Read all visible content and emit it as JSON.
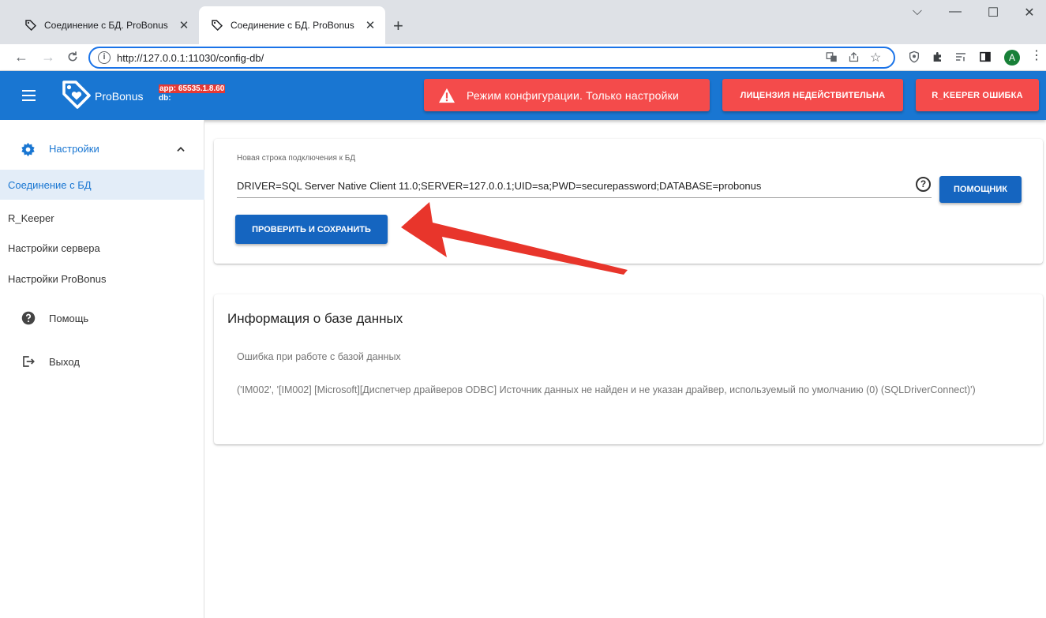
{
  "browser": {
    "tabs": [
      {
        "title": "Соединение с БД. ProBonus",
        "close": "✕"
      },
      {
        "title": "Соединение с БД. ProBonus",
        "close": "✕"
      }
    ],
    "new_tab": "+",
    "window_controls": [
      "⌵",
      "—",
      "☐",
      "✕"
    ],
    "url": "http://127.0.0.1:11030/config-db/",
    "profile_initial": "A"
  },
  "header": {
    "brand": "ProBonus",
    "app_version": "app: 65535.1.8.60",
    "db_label": "db:",
    "mode_banner": "Режим конфигурации. Только настройки",
    "license_button": "ЛИЦЕНЗИЯ НЕДЕЙСТВИТЕЛЬНА",
    "keeper_button": "R_KEEPER ОШИБКА",
    "colors": {
      "appbar": "#1976d2",
      "alert": "#f44b4b"
    }
  },
  "sidebar": {
    "section": "Настройки",
    "items": [
      {
        "label": "Соединение с БД",
        "active": true
      },
      {
        "label": "R_Keeper"
      },
      {
        "label": "Настройки сервера"
      },
      {
        "label": "Настройки ProBonus"
      }
    ],
    "help": "Помощь",
    "logout": "Выход"
  },
  "connection": {
    "label": "Новая строка подключения к БД",
    "value": "DRIVER=SQL Server Native Client 11.0;SERVER=127.0.0.1;UID=sa;PWD=securepassword;DATABASE=probonus",
    "helper_button": "ПОМОЩНИК",
    "save_button": "ПРОВЕРИТЬ И СОХРАНИТЬ"
  },
  "db_info": {
    "title": "Информация о базе данных",
    "error": "Ошибка при работе с базой данных",
    "detail": "('IM002', '[IM002] [Microsoft][Диспетчер драйверов ODBC] Источник данных не найден и не указан драйвер, используемый по умолчанию (0) (SQLDriverConnect)')"
  }
}
